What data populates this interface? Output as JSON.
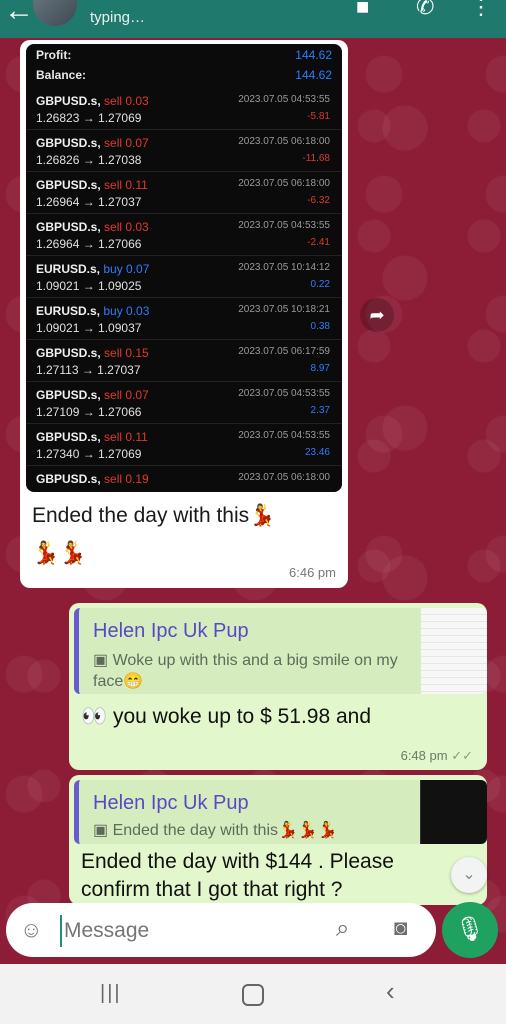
{
  "header": {
    "status": "typing…"
  },
  "incoming": {
    "summary": [
      {
        "label": "Profit:",
        "value": "144.62"
      },
      {
        "label": "Balance:",
        "value": "144.62"
      }
    ],
    "trades": [
      {
        "symbol": "GBPUSD.s,",
        "side": "sell 0.03",
        "side_type": "sell",
        "prices": "1.26823 → 1.27069",
        "time": "2023.07.05 04:53:55",
        "pl": "-5.81",
        "pl_type": "neg"
      },
      {
        "symbol": "GBPUSD.s,",
        "side": "sell 0.07",
        "side_type": "sell",
        "prices": "1.26826 → 1.27038",
        "time": "2023.07.05 06:18:00",
        "pl": "-11.68",
        "pl_type": "neg"
      },
      {
        "symbol": "GBPUSD.s,",
        "side": "sell 0.11",
        "side_type": "sell",
        "prices": "1.26964 → 1.27037",
        "time": "2023.07.05 06:18:00",
        "pl": "-6.32",
        "pl_type": "neg"
      },
      {
        "symbol": "GBPUSD.s,",
        "side": "sell 0.03",
        "side_type": "sell",
        "prices": "1.26964 → 1.27066",
        "time": "2023.07.05 04:53:55",
        "pl": "-2.41",
        "pl_type": "neg"
      },
      {
        "symbol": "EURUSD.s,",
        "side": "buy 0.07",
        "side_type": "buy",
        "prices": "1.09021 → 1.09025",
        "time": "2023.07.05 10:14:12",
        "pl": "0.22",
        "pl_type": "pos"
      },
      {
        "symbol": "EURUSD.s,",
        "side": "buy 0.03",
        "side_type": "buy",
        "prices": "1.09021 → 1.09037",
        "time": "2023.07.05 10:18:21",
        "pl": "0.38",
        "pl_type": "pos"
      },
      {
        "symbol": "GBPUSD.s,",
        "side": "sell 0.15",
        "side_type": "sell",
        "prices": "1.27113 → 1.27037",
        "time": "2023.07.05 06:17:59",
        "pl": "8.97",
        "pl_type": "pos"
      },
      {
        "symbol": "GBPUSD.s,",
        "side": "sell 0.07",
        "side_type": "sell",
        "prices": "1.27109 → 1.27066",
        "time": "2023.07.05 04:53:55",
        "pl": "2.37",
        "pl_type": "pos"
      },
      {
        "symbol": "GBPUSD.s,",
        "side": "sell 0.11",
        "side_type": "sell",
        "prices": "1.27340 → 1.27069",
        "time": "2023.07.05 04:53:55",
        "pl": "23.46",
        "pl_type": "pos"
      },
      {
        "symbol": "GBPUSD.s,",
        "side": "sell 0.19",
        "side_type": "sell",
        "prices": "",
        "time": "2023.07.05 06:18:00",
        "pl": "",
        "pl_type": "pos"
      }
    ],
    "caption": "Ended the day with this💃",
    "emoji_line": "💃💃",
    "time": "6:46 pm"
  },
  "reply1": {
    "quote_name": "Helen Ipc Uk Pup",
    "quote_text": "Woke up with this and a big smile on my face😁",
    "text": "👀 you woke up to $ 51.98 and",
    "time": "6:48 pm",
    "status_icon": "double-check"
  },
  "reply2": {
    "quote_name": "Helen Ipc Uk Pup",
    "quote_text": "Ended the day with this💃💃💃",
    "text": "Ended the day with $144 . Please confirm that I got that right ?"
  },
  "input": {
    "placeholder": "Message"
  },
  "colors": {
    "header": "#1f7a6d",
    "wallpaper": "#8d1d36",
    "outgoing_bubble": "#e2f7cb",
    "mic_button": "#1fa15f"
  }
}
